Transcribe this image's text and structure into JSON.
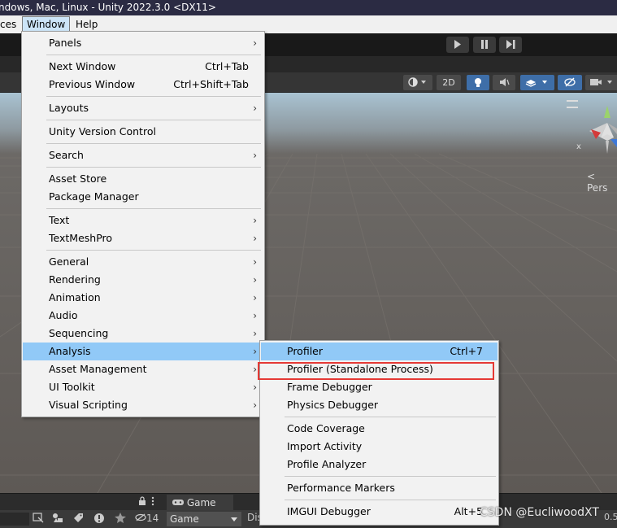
{
  "title": "ndows, Mac, Linux - Unity 2022.3.0 <DX11>",
  "menubar": [
    "ces",
    "Window",
    "Help"
  ],
  "toolbar": {
    "btn_2d": "2D"
  },
  "scene": {
    "persp_label": "< Pers",
    "gizmo_x": "x"
  },
  "window_menu": [
    {
      "label": "Panels",
      "submenu": true
    },
    {
      "label": "Next Window",
      "shortcut": "Ctrl+Tab"
    },
    {
      "label": "Previous Window",
      "shortcut": "Ctrl+Shift+Tab"
    },
    {
      "label": "Layouts",
      "submenu": true
    },
    {
      "label": "Unity Version Control"
    },
    {
      "label": "Search",
      "submenu": true
    },
    {
      "label": "Asset Store"
    },
    {
      "label": "Package Manager"
    },
    {
      "label": "Text",
      "submenu": true
    },
    {
      "label": "TextMeshPro",
      "submenu": true
    },
    {
      "label": "General",
      "submenu": true
    },
    {
      "label": "Rendering",
      "submenu": true
    },
    {
      "label": "Animation",
      "submenu": true
    },
    {
      "label": "Audio",
      "submenu": true
    },
    {
      "label": "Sequencing",
      "submenu": true
    },
    {
      "label": "Analysis",
      "submenu": true,
      "highlighted": true
    },
    {
      "label": "Asset Management",
      "submenu": true
    },
    {
      "label": "UI Toolkit",
      "submenu": true
    },
    {
      "label": "Visual Scripting",
      "submenu": true
    }
  ],
  "analysis_menu": [
    {
      "label": "Profiler",
      "shortcut": "Ctrl+7",
      "highlighted": true
    },
    {
      "label": "Profiler (Standalone Process)",
      "outlined": true
    },
    {
      "label": "Frame Debugger"
    },
    {
      "label": "Physics Debugger"
    },
    {
      "label": "Code Coverage"
    },
    {
      "label": "Import Activity"
    },
    {
      "label": "Profile Analyzer"
    },
    {
      "label": "Performance Markers"
    },
    {
      "label": "IMGUI Debugger",
      "shortcut": "Alt+5"
    }
  ],
  "bottom": {
    "game_tab": "Game",
    "game_dropdown": "Game",
    "hidden_count": "14",
    "disp_label": "Dis",
    "scale_label": "0.5"
  },
  "watermark": "CSDN @EucliwoodXT"
}
